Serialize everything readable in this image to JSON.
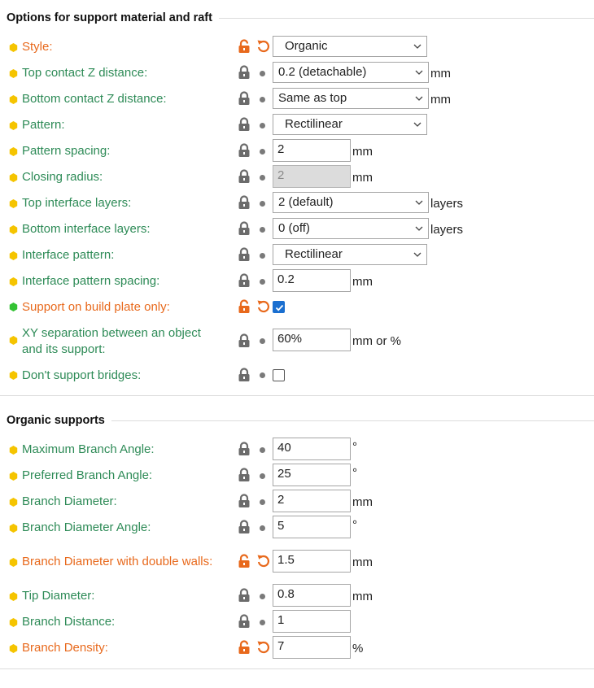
{
  "sections": {
    "support": {
      "title": "Options for support material and raft"
    },
    "organic": {
      "title": "Organic supports"
    }
  },
  "colors": {
    "bullet_yellow": "#f5c400",
    "bullet_green": "#34c234",
    "label_green": "#2e8b57",
    "label_orange": "#e8691c",
    "checkbox_blue": "#1a6fd0"
  },
  "icons": {
    "system_value": "lock-closed-icon",
    "modified_value": "lock-open-icon",
    "reset": "undo-arrow-icon",
    "same_as_system": "dot-icon"
  },
  "support_rows": {
    "style": {
      "label": "Style:",
      "value": "Organic"
    },
    "top_contact_z": {
      "label": "Top contact Z distance:",
      "value": "0.2 (detachable)",
      "unit": "mm"
    },
    "bottom_contact_z": {
      "label": "Bottom contact Z distance:",
      "value": "Same as top",
      "unit": "mm"
    },
    "pattern": {
      "label": "Pattern:",
      "value": "Rectilinear"
    },
    "pattern_spacing": {
      "label": "Pattern spacing:",
      "value": "2",
      "unit": "mm"
    },
    "closing_radius": {
      "label": "Closing radius:",
      "value": "2",
      "unit": "mm"
    },
    "top_interface_layers": {
      "label": "Top interface layers:",
      "value": "2 (default)",
      "unit": "layers"
    },
    "bottom_interface_layers": {
      "label": "Bottom interface layers:",
      "value": "0 (off)",
      "unit": "layers"
    },
    "interface_pattern": {
      "label": "Interface pattern:",
      "value": "Rectilinear"
    },
    "interface_pattern_spacing": {
      "label": "Interface pattern spacing:",
      "value": "0.2",
      "unit": "mm"
    },
    "build_plate_only": {
      "label": "Support on build plate only:",
      "checked": true
    },
    "xy_separation": {
      "label_line1": "XY separation between an object",
      "label_line2": "and its support:",
      "value": "60%",
      "unit": "mm or %"
    },
    "dont_support_bridges": {
      "label": "Don't support bridges:",
      "checked": false
    }
  },
  "organic_rows": {
    "max_branch_angle": {
      "label": "Maximum Branch Angle:",
      "value": "40",
      "unit": "°"
    },
    "preferred_branch_angle": {
      "label": "Preferred Branch Angle:",
      "value": "25",
      "unit": "°"
    },
    "branch_diameter": {
      "label": "Branch Diameter:",
      "value": "2",
      "unit": "mm"
    },
    "branch_diameter_angle": {
      "label": "Branch Diameter Angle:",
      "value": "5",
      "unit": "°"
    },
    "branch_diameter_double_walls": {
      "label": "Branch Diameter with double walls:",
      "value": "1.5",
      "unit": "mm"
    },
    "tip_diameter": {
      "label": "Tip Diameter:",
      "value": "0.8",
      "unit": "mm"
    },
    "branch_distance": {
      "label": "Branch Distance:",
      "value": "1"
    },
    "branch_density": {
      "label": "Branch Density:",
      "value": "7",
      "unit": "%"
    }
  }
}
